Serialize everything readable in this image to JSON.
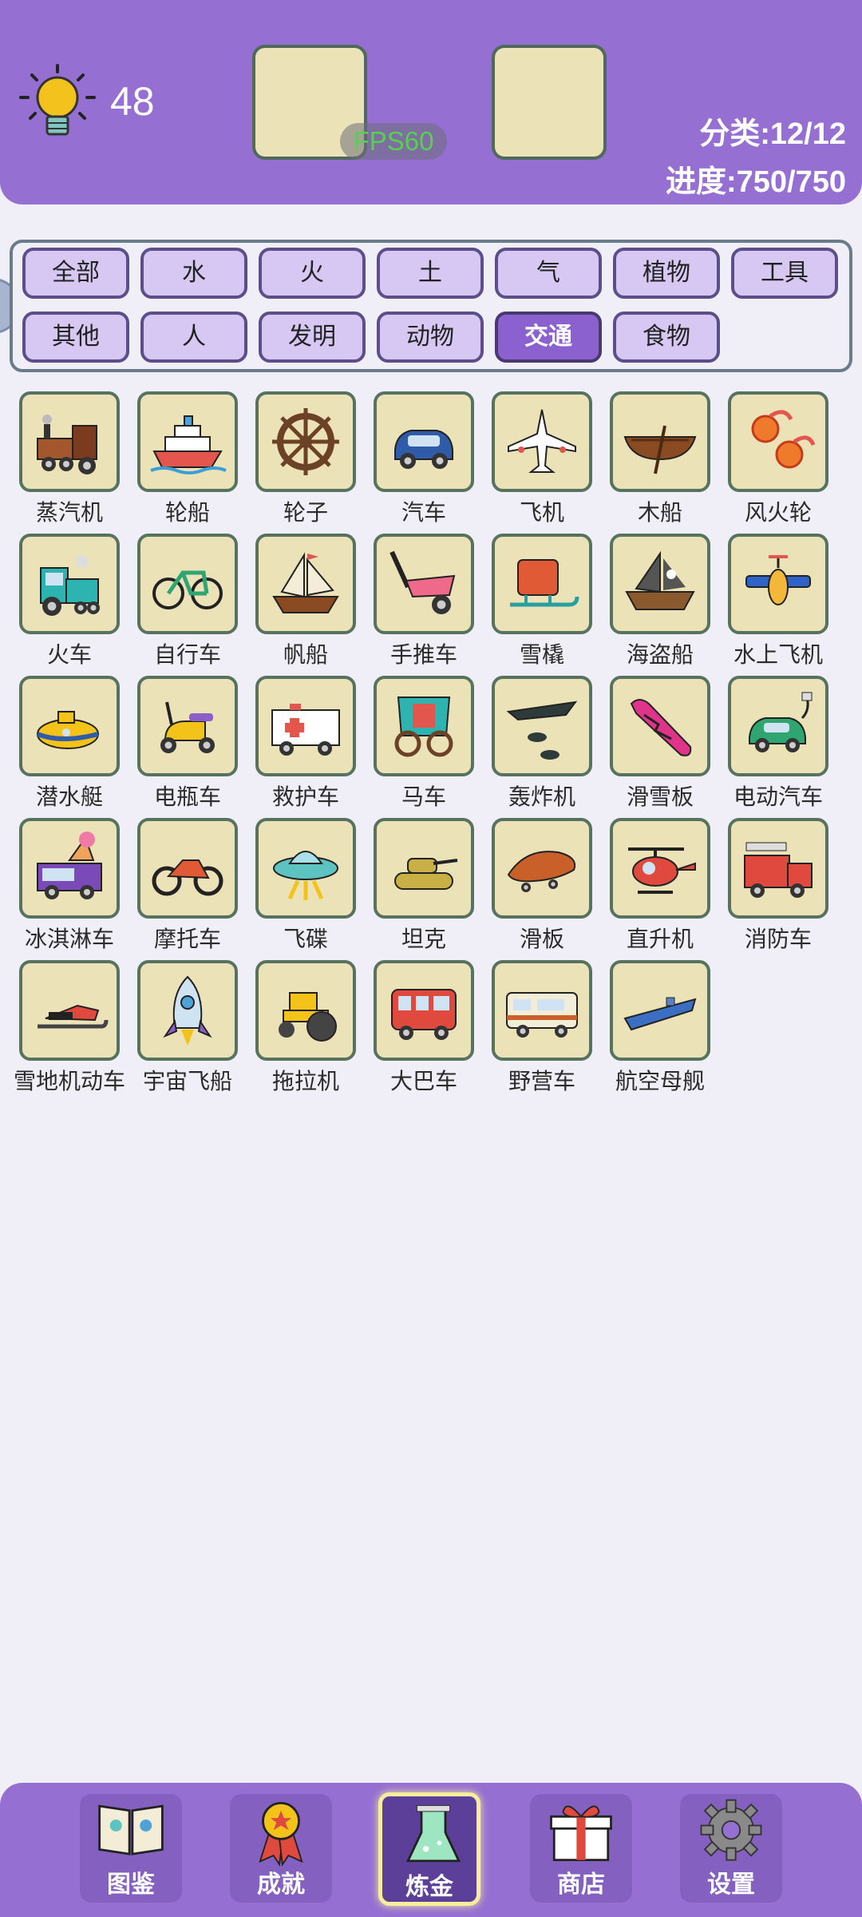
{
  "header": {
    "hint_icon": "lightbulb-icon",
    "hint_count": "48",
    "fps": "FPS60",
    "category_stat": "分类:12/12",
    "progress_stat": "进度:750/750"
  },
  "filters": [
    {
      "label": "全部",
      "active": false
    },
    {
      "label": "水",
      "active": false
    },
    {
      "label": "火",
      "active": false
    },
    {
      "label": "土",
      "active": false
    },
    {
      "label": "气",
      "active": false
    },
    {
      "label": "植物",
      "active": false
    },
    {
      "label": "工具",
      "active": false
    },
    {
      "label": "其他",
      "active": false
    },
    {
      "label": "人",
      "active": false
    },
    {
      "label": "发明",
      "active": false
    },
    {
      "label": "动物",
      "active": false
    },
    {
      "label": "交通",
      "active": true
    },
    {
      "label": "食物",
      "active": false
    }
  ],
  "items": [
    {
      "label": "蒸汽机",
      "icon": "steam-locomotive-icon"
    },
    {
      "label": "轮船",
      "icon": "ship-icon"
    },
    {
      "label": "轮子",
      "icon": "wheel-icon"
    },
    {
      "label": "汽车",
      "icon": "car-icon"
    },
    {
      "label": "飞机",
      "icon": "airplane-icon"
    },
    {
      "label": "木船",
      "icon": "rowboat-icon"
    },
    {
      "label": "风火轮",
      "icon": "fire-wheels-icon"
    },
    {
      "label": "火车",
      "icon": "train-icon"
    },
    {
      "label": "自行车",
      "icon": "bicycle-icon"
    },
    {
      "label": "帆船",
      "icon": "sailboat-icon"
    },
    {
      "label": "手推车",
      "icon": "wheelbarrow-icon"
    },
    {
      "label": "雪橇",
      "icon": "sled-icon"
    },
    {
      "label": "海盗船",
      "icon": "pirate-ship-icon"
    },
    {
      "label": "水上飞机",
      "icon": "seaplane-icon"
    },
    {
      "label": "潜水艇",
      "icon": "submarine-icon"
    },
    {
      "label": "电瓶车",
      "icon": "scooter-icon"
    },
    {
      "label": "救护车",
      "icon": "ambulance-icon"
    },
    {
      "label": "马车",
      "icon": "carriage-icon"
    },
    {
      "label": "轰炸机",
      "icon": "bomber-icon"
    },
    {
      "label": "滑雪板",
      "icon": "snowboard-icon"
    },
    {
      "label": "电动汽车",
      "icon": "electric-car-icon"
    },
    {
      "label": "冰淇淋车",
      "icon": "ice-cream-truck-icon"
    },
    {
      "label": "摩托车",
      "icon": "motorcycle-icon"
    },
    {
      "label": "飞碟",
      "icon": "ufo-icon"
    },
    {
      "label": "坦克",
      "icon": "tank-icon"
    },
    {
      "label": "滑板",
      "icon": "skateboard-icon"
    },
    {
      "label": "直升机",
      "icon": "helicopter-icon"
    },
    {
      "label": "消防车",
      "icon": "fire-truck-icon"
    },
    {
      "label": "雪地机动车",
      "icon": "snowmobile-icon"
    },
    {
      "label": "宇宙飞船",
      "icon": "rocket-icon"
    },
    {
      "label": "拖拉机",
      "icon": "tractor-icon"
    },
    {
      "label": "大巴车",
      "icon": "bus-icon"
    },
    {
      "label": "野营车",
      "icon": "camper-icon"
    },
    {
      "label": "航空母舰",
      "icon": "aircraft-carrier-icon"
    }
  ],
  "nav": [
    {
      "label": "图鉴",
      "icon": "book-icon",
      "active": false
    },
    {
      "label": "成就",
      "icon": "medal-icon",
      "active": false
    },
    {
      "label": "炼金",
      "icon": "flask-icon",
      "active": true
    },
    {
      "label": "商店",
      "icon": "gift-icon",
      "active": false
    },
    {
      "label": "设置",
      "icon": "gear-icon",
      "active": false
    }
  ]
}
